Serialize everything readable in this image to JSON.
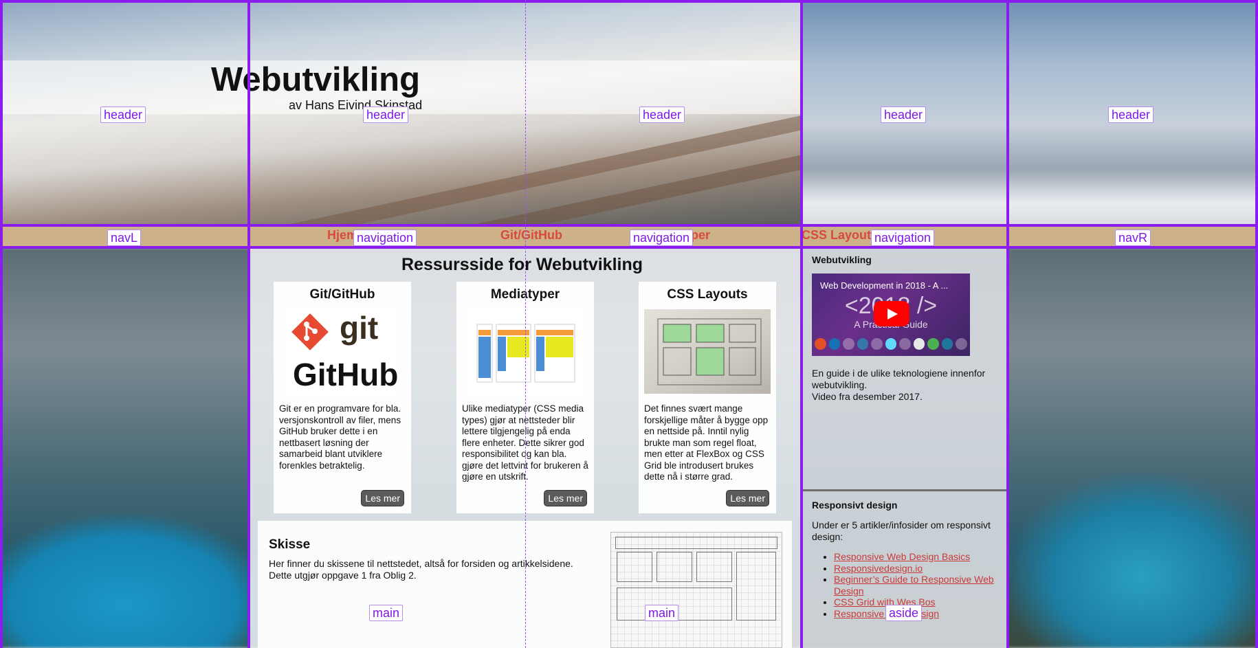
{
  "header": {
    "title": "Webutvikling",
    "subtitle": "av Hans Eivind Skinstad"
  },
  "nav": {
    "links": [
      "Hjem",
      "Git/GitHub",
      "Mediatyper",
      "CSS Layouts"
    ]
  },
  "grid_labels": {
    "header": "header",
    "navL": "navL",
    "navigation": "navigation",
    "navR": "navR",
    "main": "main",
    "aside": "aside"
  },
  "main": {
    "title": "Ressursside for Webutvikling",
    "cards": [
      {
        "title": "Git/GitHub",
        "text": "Git er en programvare for bla. versjonskontroll av filer, mens GitHub bruker dette i en nettbasert løsning der samarbeid blant utviklere forenkles betraktelig.",
        "button": "Les mer"
      },
      {
        "title": "Mediatyper",
        "text": "Ulike mediatyper (CSS media types) gjør at nettsteder blir lettere tilgjengelig på enda flere enheter. Dette sikrer god responsibilitet og kan bla. gjøre det lettvint for brukeren å gjøre en utskrift.",
        "button": "Les mer"
      },
      {
        "title": "CSS Layouts",
        "text": "Det finnes svært mange forskjellige måter å bygge opp en nettside på. Inntil nylig brukte man som regel float, men etter at FlexBox og CSS Grid ble introdusert brukes dette nå i større grad.",
        "button": "Les mer"
      }
    ],
    "git_logo": {
      "word1": "git",
      "word2": "GitHub"
    },
    "skisse": {
      "title": "Skisse",
      "text": "Her finner du skissene til nettstedet, altså for forsiden og artikkelsidene. Dette utgjør oppgave 1 fra Oblig 2."
    }
  },
  "aside": {
    "video_section": {
      "heading": "Webutvikling",
      "video_title": "Web Development in 2018 - A ...",
      "video_big": "<2018 />",
      "video_sub": "A Practical Guide",
      "text1": "En guide i de ulike teknologiene innenfor webutvikling.",
      "text2": "Video fra desember 2017."
    },
    "responsive_section": {
      "heading": "Responsivt design",
      "text": "Under er 5 artikler/infosider om responsivt design:",
      "links": [
        "Responsive Web Design Basics",
        "Responsivedesign.io",
        "Beginner’s Guide to Responsive Web Design",
        "CSS Grid with Wes Bos",
        "Responsive Web Design"
      ]
    }
  },
  "colors": {
    "grid_line": "#8a1cf0",
    "nav_bg": "#cdb189",
    "nav_link": "#d84a3c",
    "button_bg": "#5b5b5b"
  }
}
